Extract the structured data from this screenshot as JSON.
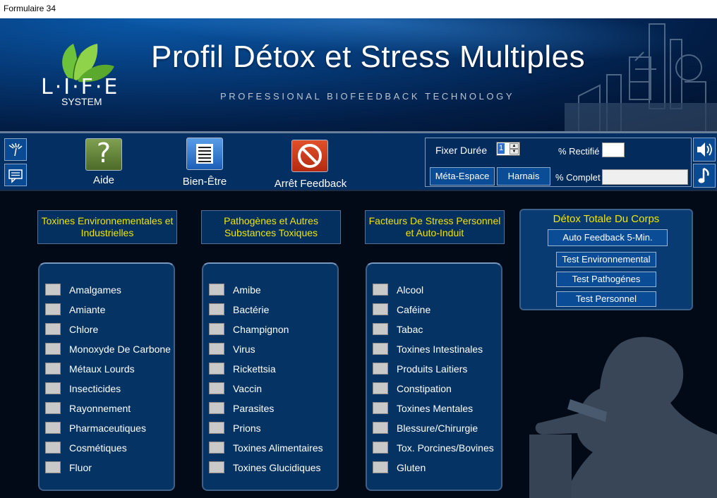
{
  "window": {
    "title": "Formulaire 34"
  },
  "header": {
    "title": "Profil Détox et Stress Multiples",
    "subtitle": "PROFESSIONAL BIOFEEDBACK TECHNOLOGY",
    "logo_text": "L·I·F·E",
    "logo_sub": "SYSTEM"
  },
  "toolbar": {
    "help_label": "Aide",
    "wellbeing_label": "Bien-Être",
    "stop_label": "Arrêt Feedback"
  },
  "controls": {
    "duration_label": "Fixer Durée",
    "duration_value": "1",
    "rectified_label": "% Rectifié",
    "rectified_value": "",
    "complete_label": "% Complet",
    "complete_value": "",
    "meta_space_label": "Méta-Espace",
    "harness_label": "Harnais"
  },
  "categories": [
    {
      "title": "Toxines Environnementales et Industrielles",
      "items": [
        "Amalgames",
        "Amiante",
        "Chlore",
        "Monoxyde De Carbone",
        "Métaux Lourds",
        "Insecticides",
        "Rayonnement",
        "Pharmaceutiques",
        "Cosmétiques",
        "Fluor"
      ]
    },
    {
      "title": "Pathogènes et Autres Substances Toxiques",
      "items": [
        "Amibe",
        "Bactérie",
        "Champignon",
        "Virus",
        "Rickettsia",
        "Vaccin",
        "Parasites",
        "Prions",
        "Toxines Alimentaires",
        "Toxines Glucidiques"
      ]
    },
    {
      "title": "Facteurs De Stress Personnel et Auto-Induit",
      "items": [
        "Alcool",
        "Caféine",
        "Tabac",
        "Toxines Intestinales",
        "Produits Laitiers",
        "Constipation",
        "Toxines Mentales",
        "Blessure/Chirurgie",
        "Tox. Porcines/Bovines",
        "Gluten"
      ]
    }
  ],
  "detox": {
    "title": "Détox Totale Du Corps",
    "auto_feedback": "Auto Feedback 5-Min.",
    "test_env": "Test Environnemental",
    "test_path": "Test Pathogénes",
    "test_pers": "Test Personnel"
  },
  "colors": {
    "accent_yellow": "#f2e500",
    "panel_blue": "#053464",
    "header_blue": "#0a58a8"
  }
}
